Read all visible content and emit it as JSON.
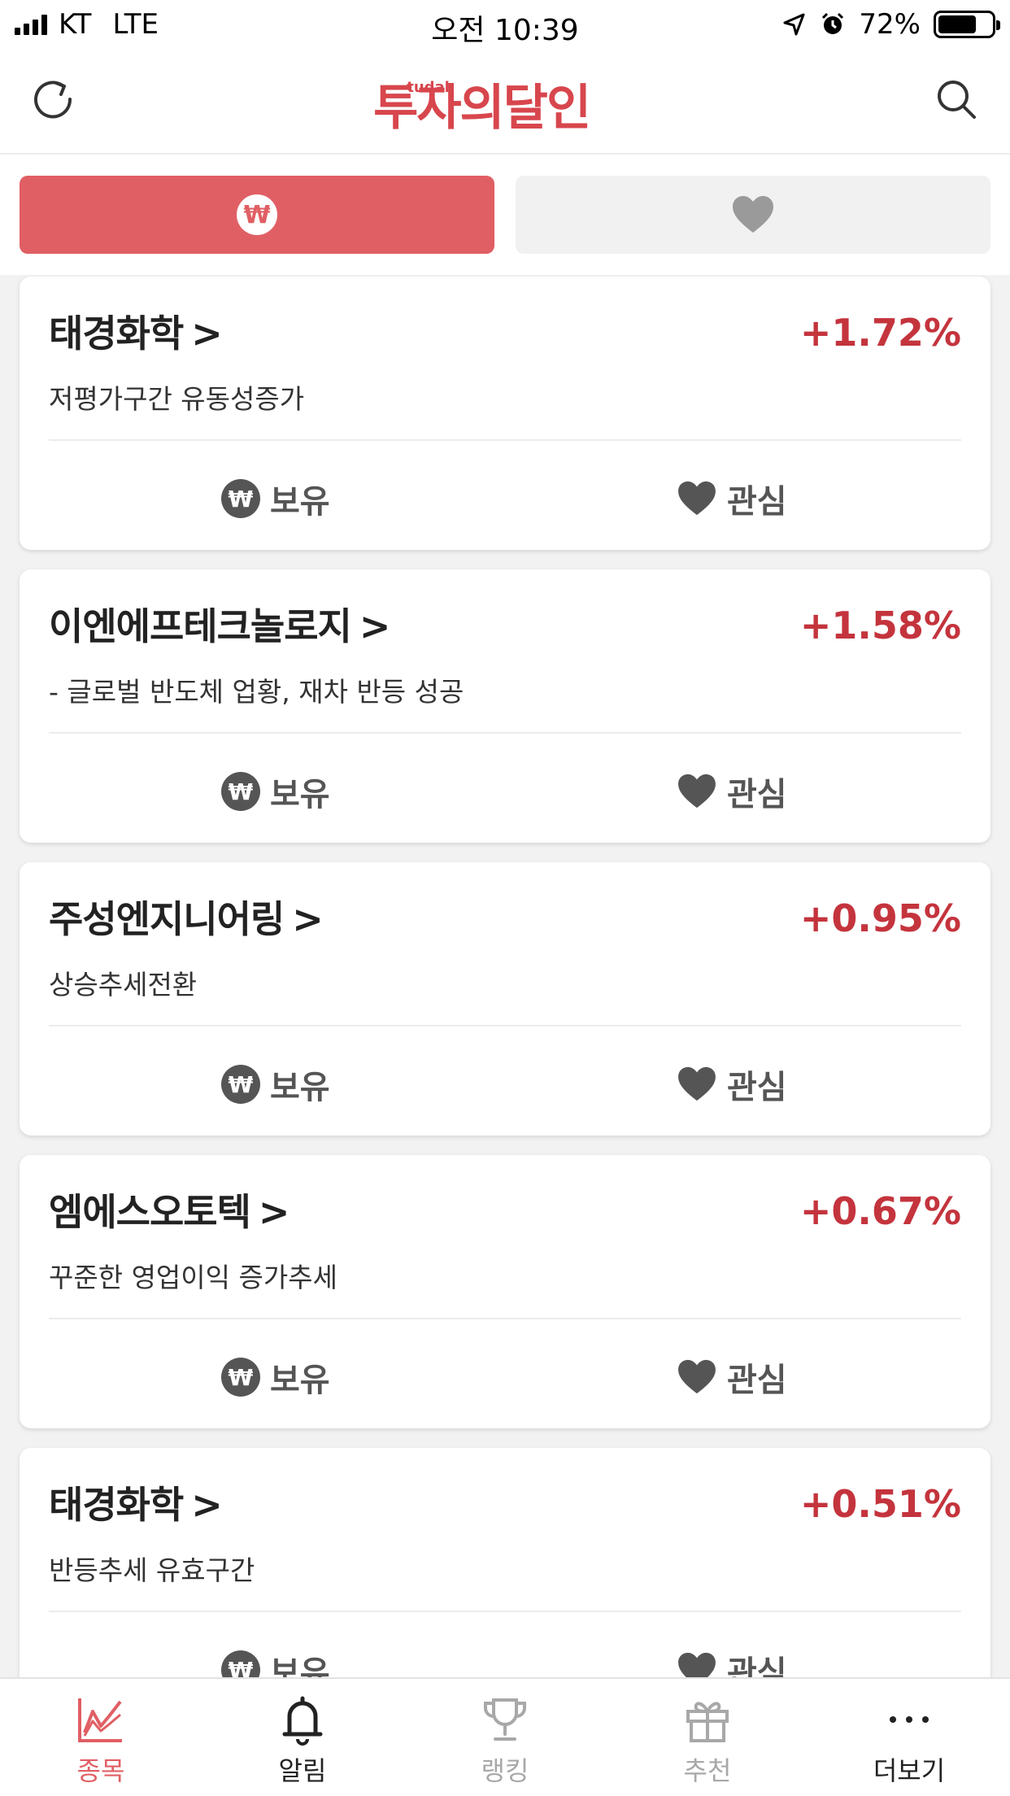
{
  "status_bar": {
    "carrier": "KT",
    "network": "LTE",
    "time": "오전 10:39",
    "battery": "72%",
    "battery_level": 0.72
  },
  "header": {
    "logo_text": "투자의달인",
    "logo_sub": "tudal"
  },
  "tabs": [
    {
      "icon": "won-icon",
      "active": true
    },
    {
      "icon": "heart-icon",
      "active": false
    }
  ],
  "cards": [
    {
      "name": "태경화학",
      "chevron": ">",
      "change": "+1.72%",
      "desc": "저평가구간 유동성증가",
      "hold_label": "보유",
      "fav_label": "관심"
    },
    {
      "name": "이엔에프테크놀로지",
      "chevron": ">",
      "change": "+1.58%",
      "desc": "- 글로벌 반도체 업황, 재차 반등 성공",
      "hold_label": "보유",
      "fav_label": "관심"
    },
    {
      "name": "주성엔지니어링",
      "chevron": ">",
      "change": "+0.95%",
      "desc": "상승추세전환",
      "hold_label": "보유",
      "fav_label": "관심"
    },
    {
      "name": "엠에스오토텍",
      "chevron": ">",
      "change": "+0.67%",
      "desc": "꾸준한 영업이익 증가추세",
      "hold_label": "보유",
      "fav_label": "관심"
    },
    {
      "name": "태경화학",
      "chevron": ">",
      "change": "+0.51%",
      "desc": "반등추세 유효구간",
      "hold_label": "보유",
      "fav_label": "관심"
    }
  ],
  "won_symbol": "₩",
  "bottom_nav": [
    {
      "label": "종목",
      "icon": "chart-icon",
      "color": "#e05f64"
    },
    {
      "label": "알림",
      "icon": "bell-icon",
      "color": "#222222"
    },
    {
      "label": "랭킹",
      "icon": "trophy-icon",
      "color": "#a8a8a8"
    },
    {
      "label": "추천",
      "icon": "gift-icon",
      "color": "#a8a8a8"
    },
    {
      "label": "더보기",
      "icon": "more-icon",
      "color": "#222222"
    }
  ],
  "colors": {
    "accent": "#e05f64",
    "positive": "#c4343d"
  }
}
